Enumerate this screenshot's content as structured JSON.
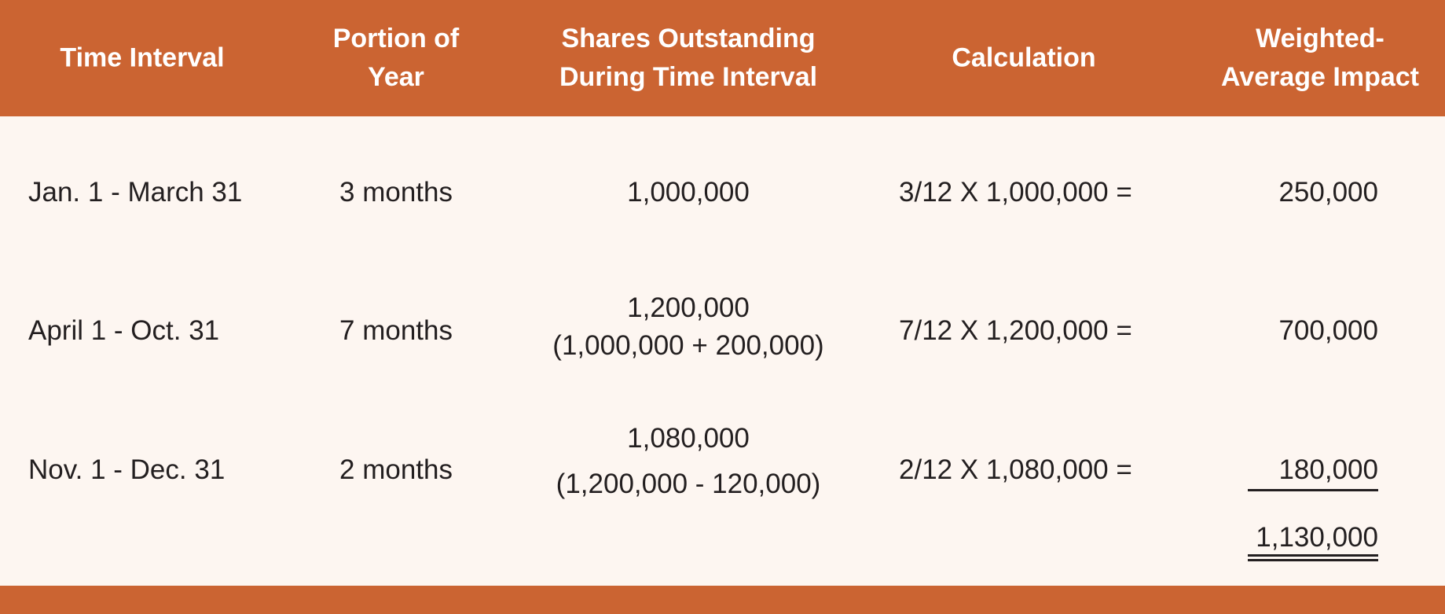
{
  "table": {
    "headers": {
      "time_interval": "Time Interval",
      "portion_of_year": [
        "Portion of",
        "Year"
      ],
      "shares_outstanding": [
        "Shares Outstanding",
        "During Time Interval"
      ],
      "calculation": "Calculation",
      "weighted_average_impact": [
        "Weighted-",
        "Average Impact"
      ]
    },
    "rows": [
      {
        "time_interval": "Jan. 1 - March 31",
        "portion_of_year": "3 months",
        "shares_outstanding": "1,000,000",
        "shares_detail": "",
        "calculation": "3/12 X 1,000,000 =",
        "weighted_average_impact": "250,000"
      },
      {
        "time_interval": "April 1 - Oct. 31",
        "portion_of_year": "7 months",
        "shares_outstanding": "1,200,000",
        "shares_detail": "(1,000,000 + 200,000)",
        "calculation": "7/12 X 1,200,000 =",
        "weighted_average_impact": "700,000"
      },
      {
        "time_interval": "Nov. 1 - Dec. 31",
        "portion_of_year": "2 months",
        "shares_outstanding": "1,080,000",
        "shares_detail": "(1,200,000 - 120,000)",
        "calculation": "2/12 X 1,080,000 =",
        "weighted_average_impact": "180,000"
      }
    ],
    "total": "1,130,000"
  },
  "colors": {
    "header_bg": "#cb6432",
    "body_bg": "#fdf6f1",
    "text": "#231f20"
  }
}
